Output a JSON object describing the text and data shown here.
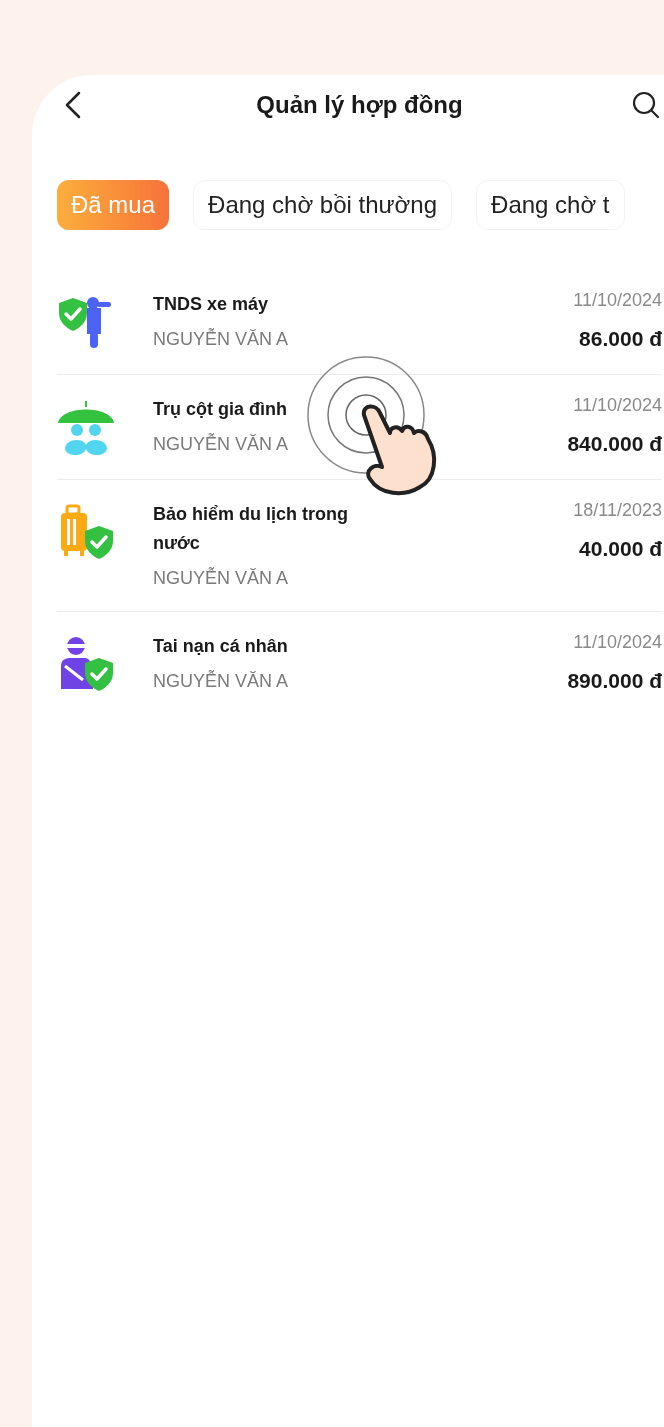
{
  "header": {
    "title": "Quản lý hợp đồng"
  },
  "tabs": [
    {
      "label": "Đã mua",
      "selected": true
    },
    {
      "label": "Đang chờ bồi thường",
      "selected": false
    },
    {
      "label": "Đang chờ t",
      "selected": false
    }
  ],
  "contracts": [
    {
      "kind": "motorbike",
      "name": "TNDS xe máy",
      "holder": "NGUYỄN VĂN A",
      "date": "11/10/2024",
      "amount": "86.000 đ"
    },
    {
      "kind": "family",
      "name": "Trụ cột gia đình",
      "holder": "NGUYỄN VĂN A",
      "date": "11/10/2024",
      "amount": "840.000 đ"
    },
    {
      "kind": "travel",
      "name": "Bảo hiểm du lịch trong nước",
      "holder": "NGUYỄN VĂN A",
      "date": "18/11/2023",
      "amount": "40.000 đ"
    },
    {
      "kind": "accident",
      "name": "Tai nạn cá nhân",
      "holder": "NGUYỄN VĂN A",
      "date": "11/10/2024",
      "amount": "890.000 đ"
    }
  ]
}
